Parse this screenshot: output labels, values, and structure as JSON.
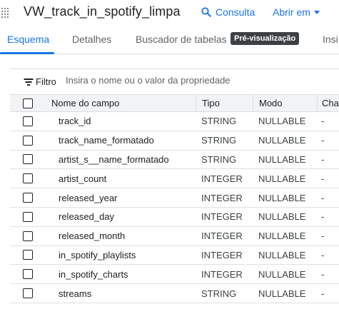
{
  "header": {
    "table_title": "VW_track_in_spotify_limpa",
    "query_label": "Consulta",
    "open_label": "Abrir em"
  },
  "tabs": [
    {
      "label": "Esquema",
      "active": true
    },
    {
      "label": "Detalhes",
      "active": false
    },
    {
      "label": "Buscador de tabelas",
      "active": false
    },
    {
      "label": "Pré-visualização",
      "active": false
    },
    {
      "label": "Insi",
      "active": false
    }
  ],
  "filter": {
    "label": "Filtro",
    "placeholder": "Insira o nome ou o valor da propriedade"
  },
  "table": {
    "columns": [
      "Nome do campo",
      "Tipo",
      "Modo",
      "Chav"
    ],
    "rows": [
      {
        "name": "track_id",
        "type": "STRING",
        "mode": "NULLABLE",
        "key": "-"
      },
      {
        "name": "track_name_formatado",
        "type": "STRING",
        "mode": "NULLABLE",
        "key": "-"
      },
      {
        "name": "artist_s__name_formatado",
        "type": "STRING",
        "mode": "NULLABLE",
        "key": "-"
      },
      {
        "name": "artist_count",
        "type": "INTEGER",
        "mode": "NULLABLE",
        "key": "-"
      },
      {
        "name": "released_year",
        "type": "INTEGER",
        "mode": "NULLABLE",
        "key": "-"
      },
      {
        "name": "released_day",
        "type": "INTEGER",
        "mode": "NULLABLE",
        "key": "-"
      },
      {
        "name": "released_month",
        "type": "INTEGER",
        "mode": "NULLABLE",
        "key": "-"
      },
      {
        "name": "in_spotify_playlists",
        "type": "INTEGER",
        "mode": "NULLABLE",
        "key": "-"
      },
      {
        "name": "in_spotify_charts",
        "type": "INTEGER",
        "mode": "NULLABLE",
        "key": "-"
      },
      {
        "name": "streams",
        "type": "STRING",
        "mode": "NULLABLE",
        "key": "-"
      }
    ]
  },
  "colors": {
    "accent": "#1a73e8",
    "badge_bg": "#3c4043",
    "header_row_bg": "#f1f3f4"
  },
  "icons": {
    "table": "table-grid-icon",
    "query": "search-icon",
    "open": "chevron-down-icon",
    "filter": "filter-icon"
  }
}
